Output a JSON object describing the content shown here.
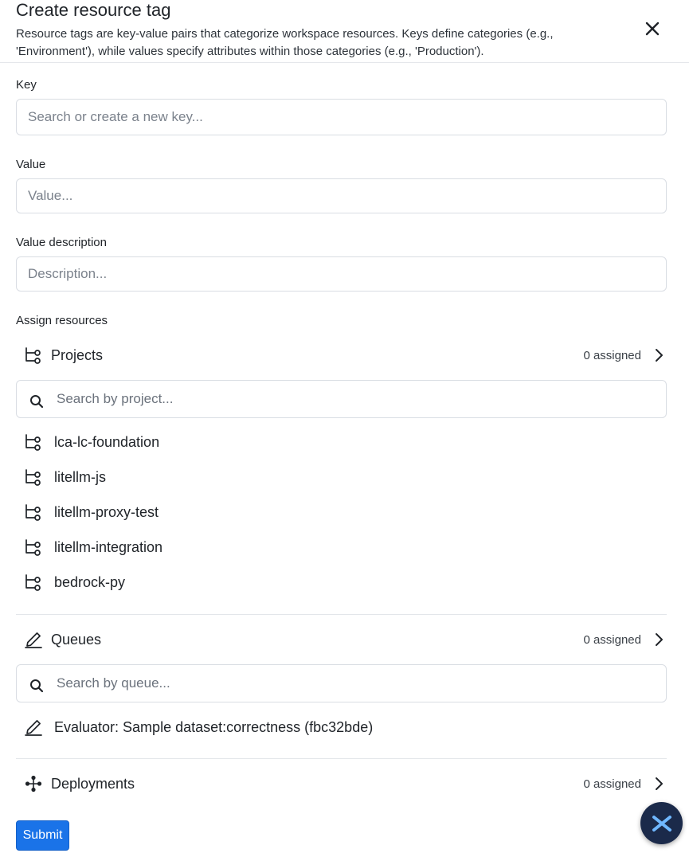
{
  "header": {
    "title": "Create resource tag",
    "subtitle": "Resource tags are key-value pairs that categorize workspace resources. Keys define categories (e.g., 'Environment'), while values specify attributes within those categories (e.g., 'Production')."
  },
  "form": {
    "key_label": "Key",
    "key_placeholder": "Search or create a new key...",
    "value_label": "Value",
    "value_placeholder": "Value...",
    "description_label": "Value description",
    "description_placeholder": "Description...",
    "assign_label": "Assign resources"
  },
  "sections": {
    "projects": {
      "label": "Projects",
      "count": "0 assigned",
      "search_placeholder": "Search by project...",
      "items": [
        "lca-lc-foundation",
        "litellm-js",
        "litellm-proxy-test",
        "litellm-integration",
        "bedrock-py"
      ]
    },
    "queues": {
      "label": "Queues",
      "count": "0 assigned",
      "search_placeholder": "Search by queue...",
      "items": [
        "Evaluator: Sample dataset:correctness (fbc32bde)"
      ]
    },
    "deployments": {
      "label": "Deployments",
      "count": "0 assigned"
    }
  },
  "actions": {
    "submit_label": "Submit"
  },
  "colors": {
    "primary": "#1a73e8",
    "chat_bubble_bg": "#1b2a4a",
    "chat_bubble_accent": "#6fb7ff"
  }
}
